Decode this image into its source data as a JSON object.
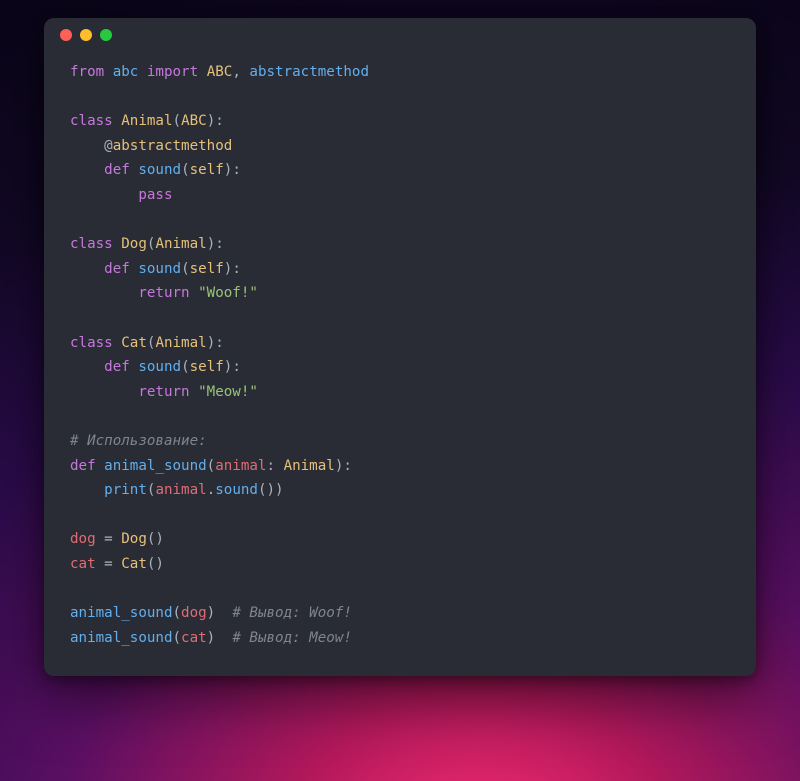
{
  "window": {
    "traffic_lights": [
      "red",
      "yellow",
      "green"
    ]
  },
  "code": {
    "l1": {
      "from": "from",
      "mod": "abc",
      "import": "import",
      "n1": "ABC",
      "comma": ", ",
      "n2": "abstractmethod"
    },
    "l3": {
      "class_kw": "class",
      "name": "Animal",
      "base": "ABC"
    },
    "l4": {
      "at": "@",
      "dec": "abstractmethod"
    },
    "l5": {
      "def": "def",
      "name": "sound",
      "self": "self"
    },
    "l6": {
      "pass": "pass"
    },
    "l8": {
      "class_kw": "class",
      "name": "Dog",
      "base": "Animal"
    },
    "l9": {
      "def": "def",
      "name": "sound",
      "self": "self"
    },
    "l10": {
      "return": "return",
      "str": "\"Woof!\""
    },
    "l12": {
      "class_kw": "class",
      "name": "Cat",
      "base": "Animal"
    },
    "l13": {
      "def": "def",
      "name": "sound",
      "self": "self"
    },
    "l14": {
      "return": "return",
      "str": "\"Meow!\""
    },
    "l16": {
      "comment": "# Использование:"
    },
    "l17": {
      "def": "def",
      "name": "animal_sound",
      "param": "animal",
      "colon": ": ",
      "type": "Animal"
    },
    "l18": {
      "print": "print",
      "obj": "animal",
      "dot": ".",
      "method": "sound"
    },
    "l20": {
      "var": "dog",
      "eq": " = ",
      "ctor": "Dog"
    },
    "l21": {
      "var": "cat",
      "eq": " = ",
      "ctor": "Cat"
    },
    "l23": {
      "fn": "animal_sound",
      "arg": "dog",
      "comment": "# Вывод: Woof!"
    },
    "l24": {
      "fn": "animal_sound",
      "arg": "cat",
      "comment": "# Вывод: Meow!"
    }
  }
}
